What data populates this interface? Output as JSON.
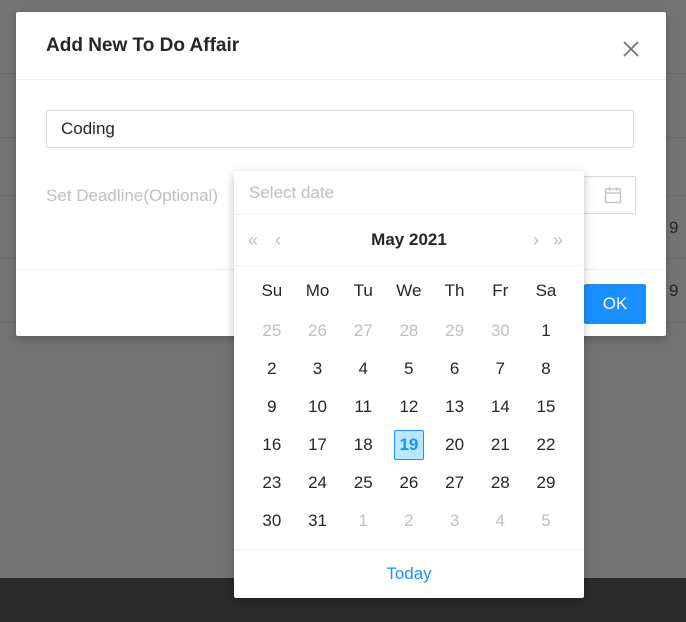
{
  "background": {
    "side_numbers": [
      "9",
      "9"
    ]
  },
  "modal": {
    "title": "Add New To Do Affair",
    "close_icon": "close-icon",
    "task_input_value": "Coding",
    "deadline_label": "Set Deadline(Optional)",
    "calendar_icon": "calendar-icon",
    "ok_label": "OK"
  },
  "picker": {
    "placeholder": "Select date",
    "super_prev": "«",
    "prev": "‹",
    "next": "›",
    "super_next": "»",
    "month": "May",
    "year": "2021",
    "weekdays": [
      "Su",
      "Mo",
      "Tu",
      "We",
      "Th",
      "Fr",
      "Sa"
    ],
    "weeks": [
      [
        "25",
        "26",
        "27",
        "28",
        "29",
        "30",
        "1"
      ],
      [
        "2",
        "3",
        "4",
        "5",
        "6",
        "7",
        "8"
      ],
      [
        "9",
        "10",
        "11",
        "12",
        "13",
        "14",
        "15"
      ],
      [
        "16",
        "17",
        "18",
        "19",
        "20",
        "21",
        "22"
      ],
      [
        "23",
        "24",
        "25",
        "26",
        "27",
        "28",
        "29"
      ],
      [
        "30",
        "31",
        "1",
        "2",
        "3",
        "4",
        "5"
      ]
    ],
    "selected_day": "19",
    "today_label": "Today"
  },
  "colors": {
    "primary": "#1890ff",
    "selected_bg": "#bae7ff",
    "disabled_text": "#bfbfbf"
  }
}
